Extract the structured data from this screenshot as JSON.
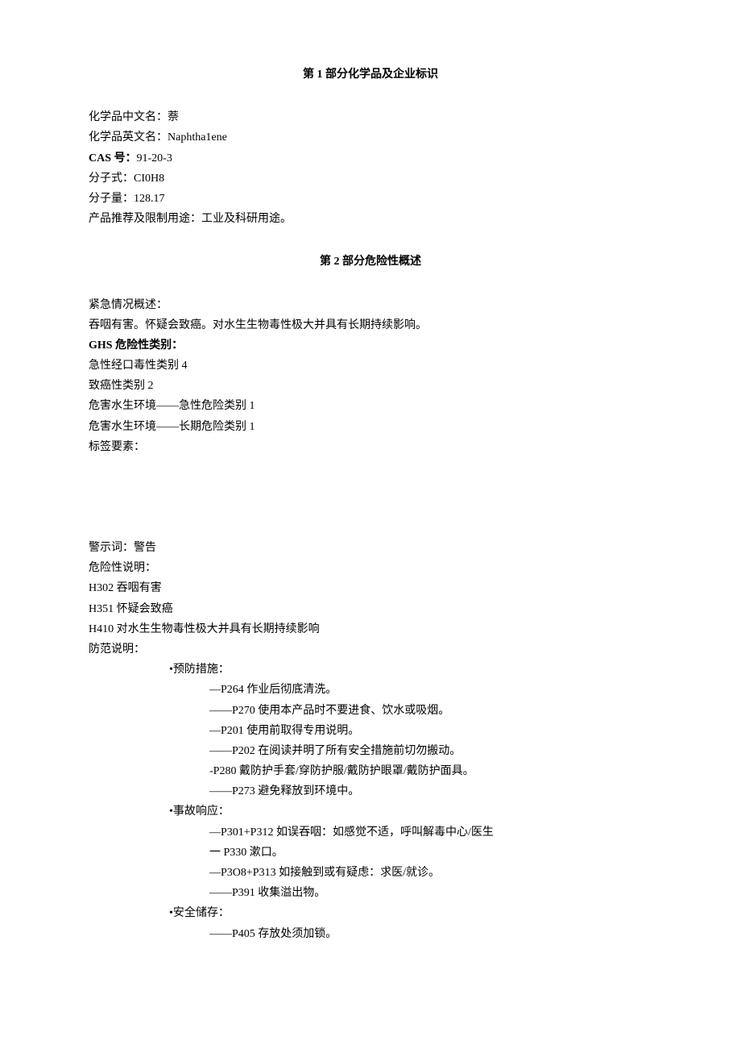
{
  "section1": {
    "title": "第 1 部分化学品及企业标识",
    "fields": {
      "name_cn_label": "化学品中文名：",
      "name_cn_value": "萘",
      "name_en_label": "化学品英文名：",
      "name_en_value": "Naphtha1ene",
      "cas_label": "CAS 号：",
      "cas_value": "91-20-3",
      "formula_label": "分子式：",
      "formula_value": "CI0H8",
      "mw_label": "分子量：",
      "mw_value": "128.17",
      "use_label": "产品推荐及限制用途：",
      "use_value": "工业及科研用途。"
    }
  },
  "section2": {
    "title": "第 2 部分危险性概述",
    "emergency_label": "紧急情况概述：",
    "emergency_text": "吞咽有害。怀疑会致癌。对水生生物毒性极大并具有长期持续影响。",
    "ghs_label": "GHS 危险性类别：",
    "ghs_categories": [
      "急性经口毒性类别 4",
      "致癌性类别 2",
      "危害水生环境——急性危险类别 1",
      "危害水生环境——长期危险类别 1"
    ],
    "label_element": "标签要素：",
    "signal_word_label": "警示词：",
    "signal_word_value": "警告",
    "hazard_statement_label": "危险性说明：",
    "hazard_statements": [
      "H302 吞咽有害",
      "H351 怀疑会致癌",
      "H410 对水生生物毒性极大并具有长期持续影响"
    ],
    "precaution_label": "防范说明：",
    "prevention": {
      "heading": "•预防措施：",
      "items": [
        "—P264 作业后彻底清洗。",
        "——P270 使用本产品时不要进食、饮水或吸烟。",
        "—P201 使用前取得专用说明。",
        "——P202 在阅读并明了所有安全措施前切勿搬动。",
        "-P280 戴防护手套/穿防护服/戴防护眼罩/戴防护面具。",
        "——P273 避免释放到环境中。"
      ]
    },
    "response": {
      "heading": "•事故响应：",
      "items": [
        "—P301+P312 如误吞咽：如感觉不适，呼叫解毒中心/医生",
        "一 P330 漱口。",
        "—P3O8+P313 如接触到或有疑虑：求医/就诊。",
        "——P391 收集溢出物。"
      ]
    },
    "storage": {
      "heading": "•安全储存：",
      "items": [
        "——P405 存放处须加锁。"
      ]
    }
  }
}
